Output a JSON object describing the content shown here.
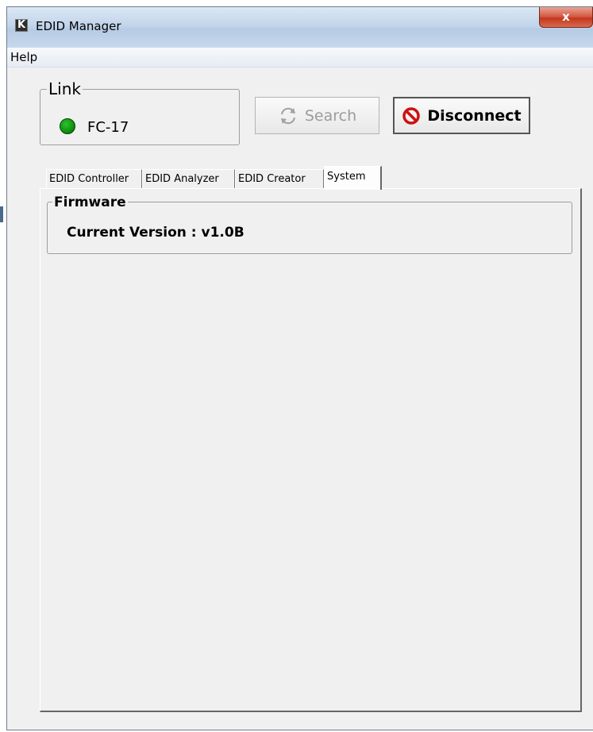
{
  "window": {
    "title": "EDID Manager",
    "close_glyph": "x",
    "app_icon_letter": "K"
  },
  "menu": {
    "items": [
      "Help"
    ]
  },
  "link": {
    "legend": "Link",
    "device": "FC-17",
    "status_color": "#0a8a0a"
  },
  "toolbar": {
    "search_label": "Search",
    "search_icon": "refresh-icon",
    "disconnect_label": "Disconnect",
    "disconnect_icon": "prohibited-icon"
  },
  "tabs": [
    {
      "label": "EDID Controller",
      "active": false
    },
    {
      "label": "EDID Analyzer",
      "active": false
    },
    {
      "label": "EDID Creator",
      "active": false
    },
    {
      "label": "System",
      "active": true
    }
  ],
  "firmware": {
    "legend": "Firmware",
    "version_text": "Current Version : v1.0B"
  }
}
